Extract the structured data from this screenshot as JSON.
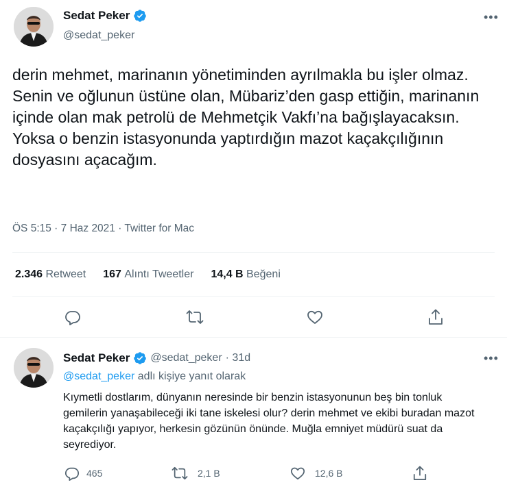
{
  "tweet": {
    "author_name": "Sedat Peker",
    "author_handle": "@sedat_peker",
    "text": "derin mehmet, marinanın yönetiminden ayrılmakla bu işler olmaz. Senin ve oğlunun üstüne olan, Mübariz’den gasp ettiğin, marinanın içinde olan mak petrolü de Mehmetçik Vakfı’na bağışlayacaksın. Yoksa o benzin istasyonunda yaptırdığın mazot kaçakçılığının dosyasını açacağım.",
    "meta": "ÖS 5:15 · 7 Haz 2021 · Twitter for Mac",
    "stats": {
      "retweets_num": "2.346",
      "retweets_label": "Retweet",
      "quotes_num": "167",
      "quotes_label": "Alıntı Tweetler",
      "likes_num": "14,4 B",
      "likes_label": "Beğeni"
    },
    "actions": [
      "reply-icon",
      "retweet-icon",
      "like-icon",
      "share-icon"
    ]
  },
  "reply": {
    "author_name": "Sedat Peker",
    "author_handle": "@sedat_peker",
    "time": "· 31d",
    "reply_to_handle": "@sedat_peker",
    "reply_to_suffix": "adlı kişiye yanıt olarak",
    "text": "Kıymetli dostlarım, dünyanın neresinde bir benzin istasyonunun beş bin tonluk gemilerin yanaşabileceği iki tane iskelesi olur? derin mehmet ve ekibi buradan mazot kaçakçılığı yapıyor, herkesin gözünün önünde. Muğla emniyet müdürü suat da seyrediyor.",
    "counts": {
      "replies": "465",
      "retweets": "2,1 B",
      "likes": "12,6 B"
    }
  },
  "colors": {
    "verified": "#1d9bf0",
    "secondary": "#536471",
    "link": "#1d9bf0",
    "divider": "#eff3f4"
  }
}
